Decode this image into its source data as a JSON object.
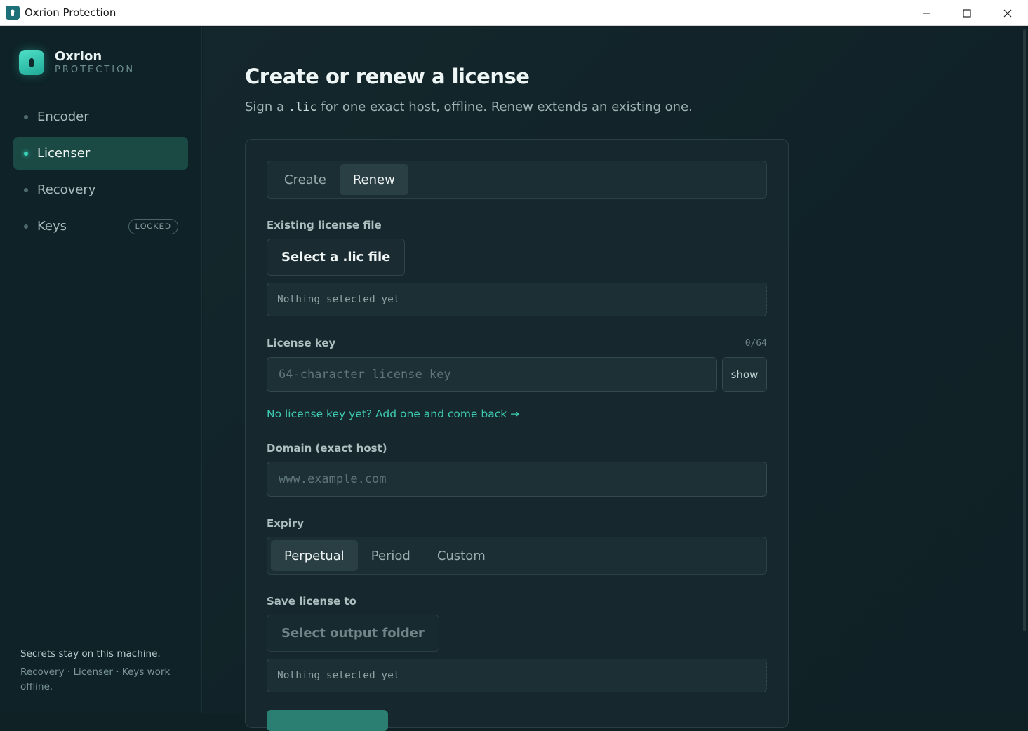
{
  "window": {
    "title": "Oxrion Protection"
  },
  "sidebar": {
    "brand": {
      "name": "Oxrion",
      "subtitle": "PROTECTION"
    },
    "items": [
      {
        "label": "Encoder",
        "active": false
      },
      {
        "label": "Licenser",
        "active": true
      },
      {
        "label": "Recovery",
        "active": false
      },
      {
        "label": "Keys",
        "active": false,
        "badge": "LOCKED"
      }
    ],
    "footer": {
      "line1": "Secrets stay on this machine.",
      "line2": "Recovery · Licenser · Keys work offline."
    }
  },
  "main": {
    "title": "Create or renew a license",
    "subtitle_before": "Sign a ",
    "subtitle_code": ".lic",
    "subtitle_after": " for one exact host, offline. Renew extends an existing one.",
    "mode_tabs": [
      {
        "label": "Create",
        "selected": false
      },
      {
        "label": "Renew",
        "selected": true
      }
    ],
    "existing_file": {
      "label": "Existing license file",
      "button": "Select a .lic file",
      "path": "Nothing selected yet"
    },
    "license_key": {
      "label": "License key",
      "counter": "0/64",
      "placeholder": "64-character license key",
      "value": "",
      "show_button": "show",
      "help_link": "No license key yet? Add one and come back →"
    },
    "domain": {
      "label": "Domain (exact host)",
      "placeholder": "www.example.com",
      "value": ""
    },
    "expiry": {
      "label": "Expiry",
      "options": [
        {
          "label": "Perpetual",
          "selected": true
        },
        {
          "label": "Period",
          "selected": false
        },
        {
          "label": "Custom",
          "selected": false
        }
      ]
    },
    "output": {
      "label": "Save license to",
      "button": "Select output folder",
      "path": "Nothing selected yet"
    }
  },
  "colors": {
    "accent": "#39d3b7",
    "link": "#3dcbb2",
    "background": "#102126",
    "sidebar_active": "#1b4a45"
  }
}
